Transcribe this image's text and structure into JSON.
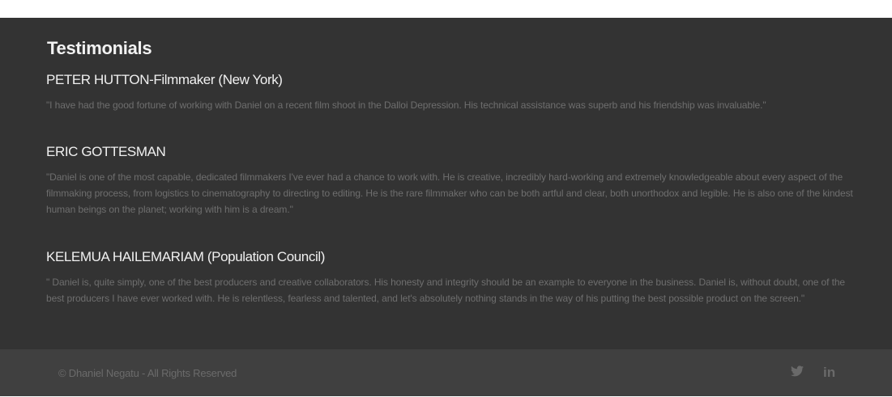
{
  "testimonials": {
    "title": "Testimonials",
    "items": [
      {
        "author": "PETER HUTTON-Filmmaker (New York)",
        "quote": "\"I have had the good fortune of working with Daniel on a recent film shoot in the Dalloi Depression. His technical assistance was superb and his friendship was invaluable.\""
      },
      {
        "author": "ERIC GOTTESMAN",
        "quote": "\"Daniel is one of the most capable, dedicated filmmakers I've ever had a chance to work with. He is creative, incredibly hard-working and extremely knowledgeable about every aspect of the filmmaking process, from logistics to cinematography to directing to editing. He is the rare filmmaker who can be both artful and clear, both unorthodox and legible. He is also one of the kindest human beings on the planet; working with him is a dream.\""
      },
      {
        "author": "KELEMUA HAILEMARIAM (Population Council)",
        "quote": "\" Daniel is, quite simply, one of the best producers and creative collaborators. His honesty and integrity should be an example to everyone in the business. Daniel is, without doubt, one of the best producers I have ever worked with. He is relentless, fearless and talented, and let's absolutely nothing stands in the way of his putting the best possible product on the screen.\""
      }
    ]
  },
  "footer": {
    "copyright": "© Dhaniel Negatu - All Rights Reserved",
    "social": [
      {
        "icon": "twitter-icon"
      },
      {
        "icon": "linkedin-icon",
        "label": "in"
      }
    ]
  },
  "colors": {
    "section_background": "#333333",
    "footer_background": "#404040",
    "heading_text": "#f2f2f2",
    "quote_text": "#6e6e6e",
    "footer_text": "#6b6b6b"
  }
}
